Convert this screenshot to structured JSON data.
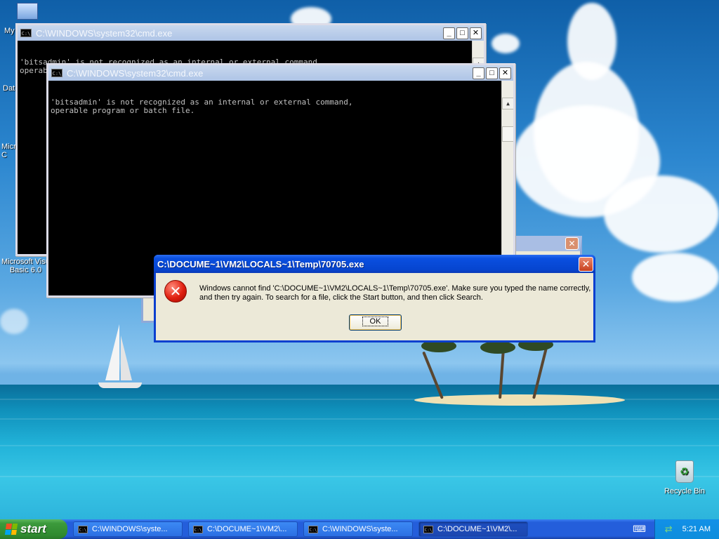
{
  "desktop": {
    "icons": [
      {
        "label": "My"
      },
      {
        "label": "Dat"
      },
      {
        "label": "Micro\nC"
      },
      {
        "label": "Microsoft Visu\nBasic 6.0"
      }
    ],
    "recycle_bin": "Recycle Bin"
  },
  "cmd_back": {
    "title": "C:\\WINDOWS\\system32\\cmd.exe",
    "output": "'bitsadmin' is not recognized as an internal or external command,\noperable program or batch file."
  },
  "cmd_front": {
    "title": "C:\\WINDOWS\\system32\\cmd.exe",
    "output": "'bitsadmin' is not recognized as an internal or external command,\noperable program or batch file."
  },
  "error_dialog": {
    "title": "C:\\DOCUME~1\\VM2\\LOCALS~1\\Temp\\70705.exe",
    "message": "Windows cannot find 'C:\\DOCUME~1\\VM2\\LOCALS~1\\Temp\\70705.exe'. Make sure you typed the name correctly, and then try again. To search for a file, click the Start button, and then click Search.",
    "ok_label": "OK",
    "icon": "error-icon"
  },
  "taskbar": {
    "start_label": "start",
    "tasks": [
      {
        "label": "C:\\WINDOWS\\syste...",
        "active": false
      },
      {
        "label": "C:\\DOCUME~1\\VM2\\...",
        "active": false
      },
      {
        "label": "C:\\WINDOWS\\syste...",
        "active": false
      },
      {
        "label": "C:\\DOCUME~1\\VM2\\...",
        "active": true
      }
    ],
    "clock": "5:21 AM"
  }
}
